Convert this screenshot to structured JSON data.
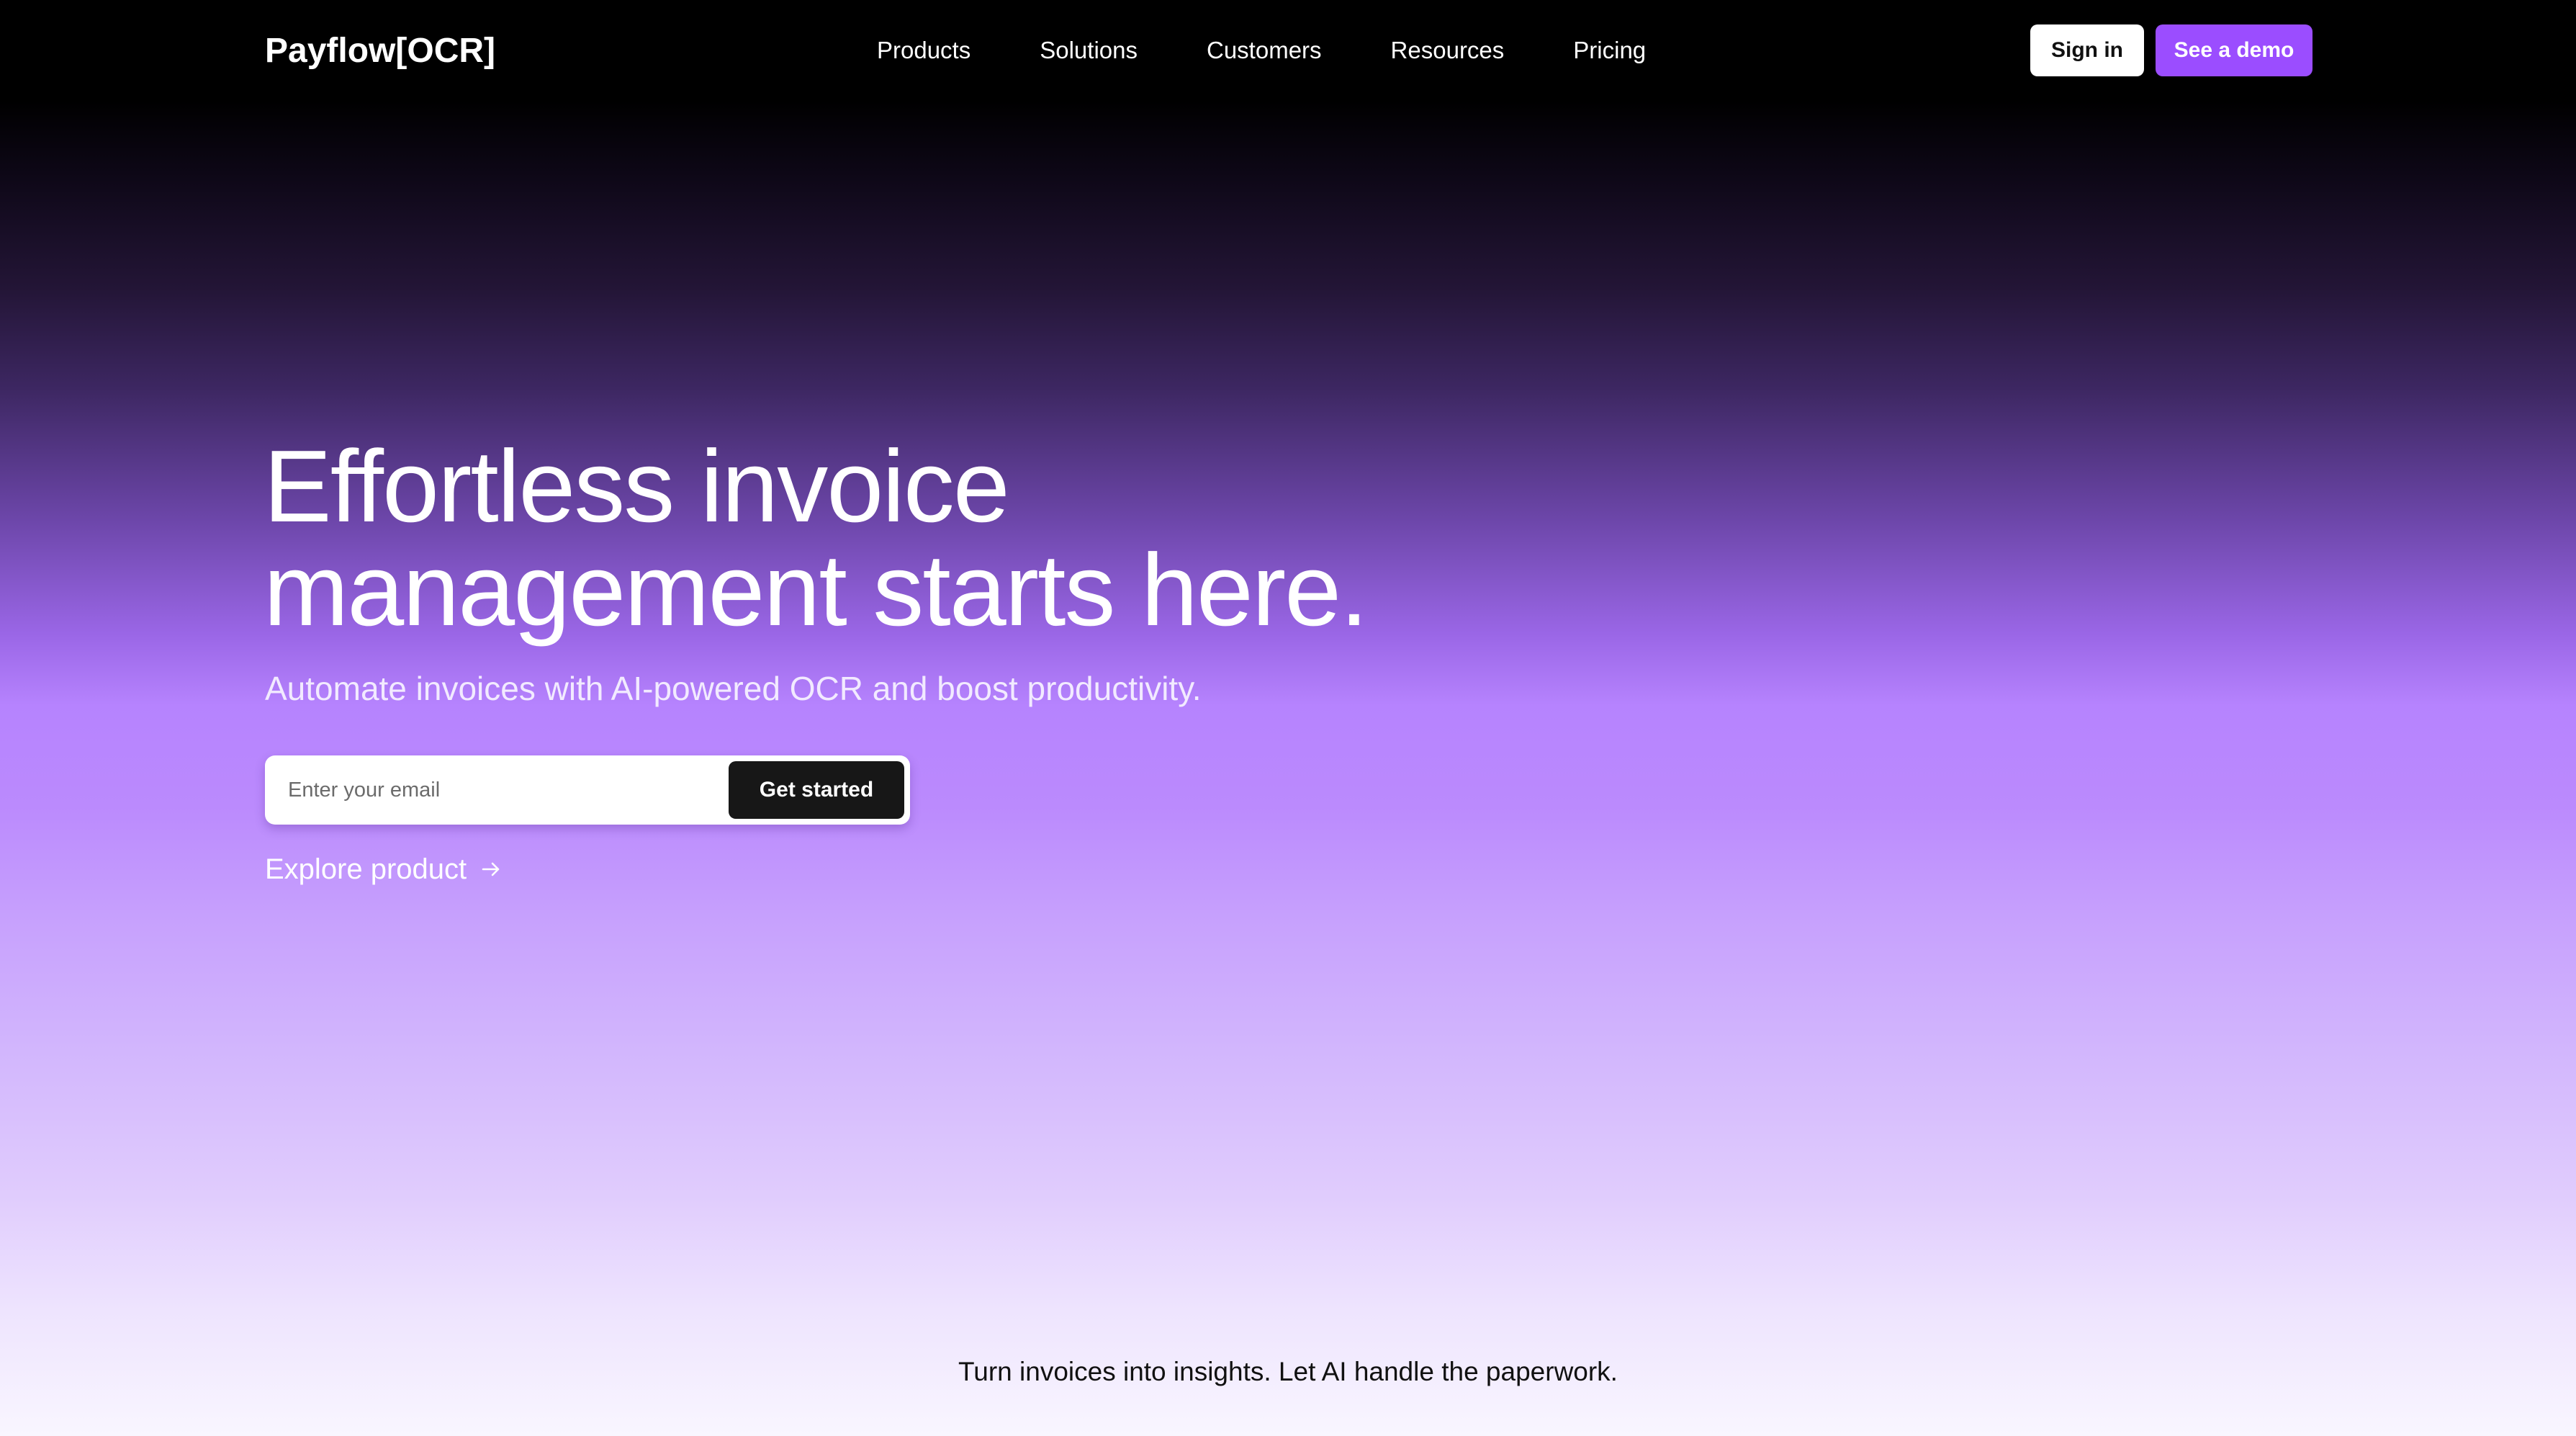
{
  "brand": {
    "logo_text": "Payflow[OCR]"
  },
  "nav": {
    "links": [
      "Products",
      "Solutions",
      "Customers",
      "Resources",
      "Pricing"
    ],
    "sign_in_label": "Sign in",
    "demo_label": "See a demo"
  },
  "hero": {
    "title_line_1": "Effortless invoice",
    "title_line_2": "management starts here.",
    "subtitle": "Automate invoices with AI-powered OCR and boost productivity.",
    "email_placeholder": "Enter your email",
    "email_value": "",
    "cta_label": "Get started",
    "explore_label": "Explore product",
    "explore_icon": "arrow-right-icon"
  },
  "tagline": "Turn invoices into insights. Let AI handle the paperwork.",
  "colors": {
    "accent": "#9b4dff",
    "nav_bg": "#000000",
    "cta_bg": "#171717",
    "gradient_mid": "#b683fe",
    "gradient_bottom": "#f9f6ff"
  }
}
